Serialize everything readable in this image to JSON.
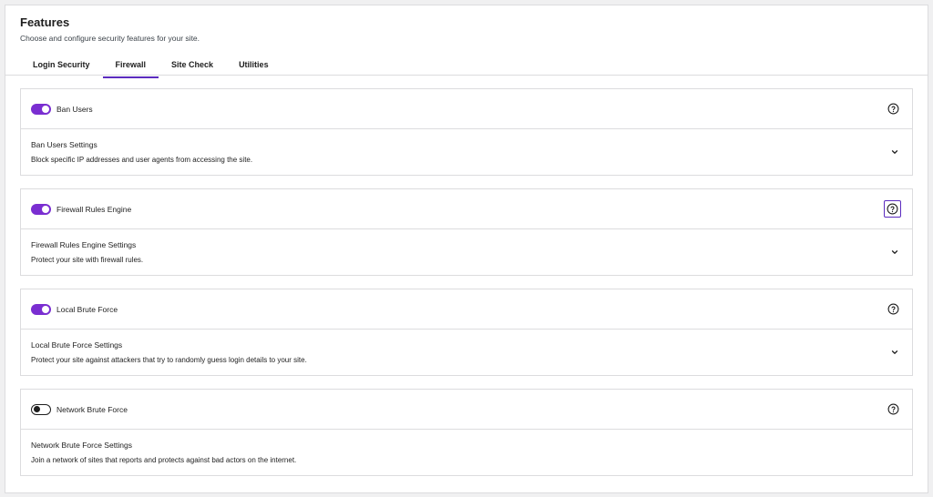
{
  "header": {
    "title": "Features",
    "subtitle": "Choose and configure security features for your site."
  },
  "tabs": [
    {
      "label": "Login Security",
      "active": false
    },
    {
      "label": "Firewall",
      "active": true
    },
    {
      "label": "Site Check",
      "active": false
    },
    {
      "label": "Utilities",
      "active": false
    }
  ],
  "features": [
    {
      "name": "Ban Users",
      "enabled": true,
      "settings_title": "Ban Users Settings",
      "settings_desc": "Block specific IP addresses and user agents from accessing the site.",
      "expandable": true
    },
    {
      "name": "Firewall Rules Engine",
      "enabled": true,
      "settings_title": "Firewall Rules Engine Settings",
      "settings_desc": "Protect your site with firewall rules.",
      "expandable": true
    },
    {
      "name": "Local Brute Force",
      "enabled": true,
      "settings_title": "Local Brute Force Settings",
      "settings_desc": "Protect your site against attackers that try to randomly guess login details to your site.",
      "expandable": true
    },
    {
      "name": "Network Brute Force",
      "enabled": false,
      "settings_title": "Network Brute Force Settings",
      "settings_desc": "Join a network of sites that reports and protects against bad actors on the internet.",
      "expandable": false
    }
  ],
  "colors": {
    "accent": "#5b2bbf",
    "toggle_on": "#7a2ed1",
    "border": "#dcdcde"
  },
  "icons": {
    "help": "question-circle-icon",
    "expand": "chevron-down-icon"
  }
}
